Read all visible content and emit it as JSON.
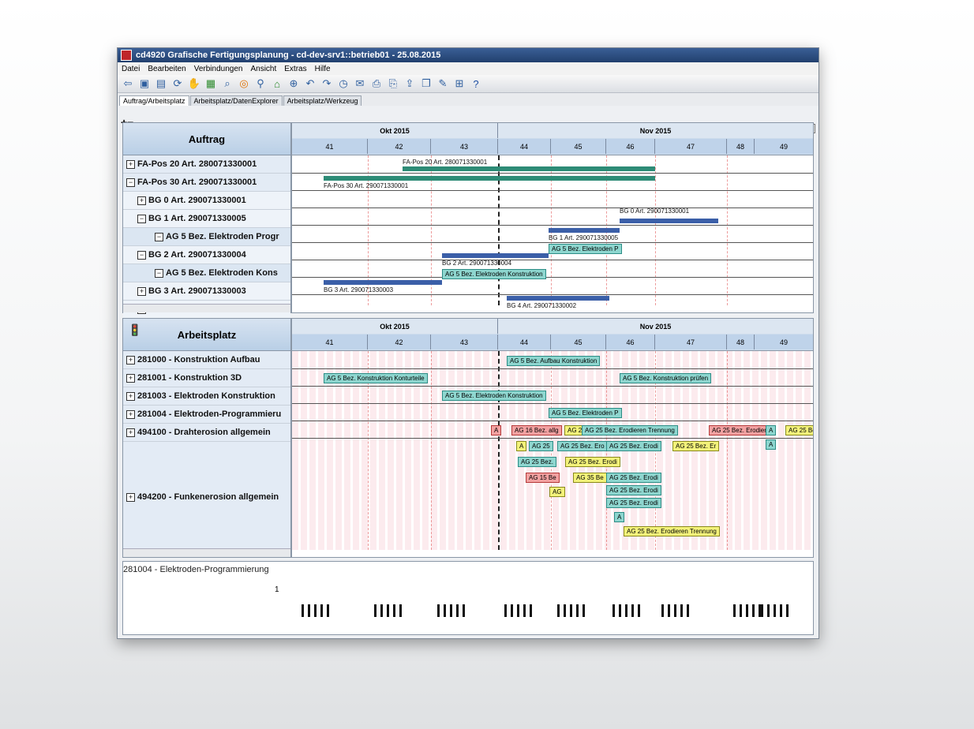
{
  "window": {
    "title": "cd4920 Grafische Fertigungsplanung - cd-dev-srv1::betrieb01 - 25.08.2015",
    "menu": [
      "Datei",
      "Bearbeiten",
      "Verbindungen",
      "Ansicht",
      "Extras",
      "Hilfe"
    ],
    "tabs": [
      "Auftrag/Arbeitsplatz",
      "Arbeitsplatz/DatenExplorer",
      "Arbeitsplatz/Werkzeug"
    ]
  },
  "toolbar_icons": [
    "exit-icon",
    "save-icon",
    "save-all-icon",
    "refresh-icon",
    "hand-icon",
    "list-icon",
    "zoom-icon",
    "target-icon",
    "search-icon",
    "tree-icon",
    "zoom-in-icon",
    "undo-icon",
    "redo-icon",
    "clock-icon",
    "mail-icon",
    "print-icon",
    "print-preview-icon",
    "export-icon",
    "copy-icon",
    "tools-icon",
    "table-icon",
    "help-icon"
  ],
  "upper": {
    "header": "Auftrag",
    "rows": [
      {
        "toggle": "+",
        "label": "FA-Pos 20 Art. 280071330001",
        "indent": 0
      },
      {
        "toggle": "−",
        "label": "FA-Pos 30 Art. 290071330001",
        "indent": 0
      },
      {
        "toggle": "+",
        "label": "BG 0  Art. 290071330001",
        "indent": 1
      },
      {
        "toggle": "−",
        "label": "BG 1  Art. 290071330005",
        "indent": 1
      },
      {
        "toggle": "−",
        "label": "AG 5 Bez. Elektroden Progr",
        "indent": 2
      },
      {
        "toggle": "−",
        "label": "BG 2  Art. 290071330004",
        "indent": 1
      },
      {
        "toggle": "−",
        "label": "AG 5 Bez. Elektroden Kons",
        "indent": 2
      },
      {
        "toggle": "+",
        "label": "BG 3  Art. 290071330003",
        "indent": 1
      },
      {
        "toggle": "+",
        "label": "BG 4  Art. 290071330002",
        "indent": 1
      }
    ]
  },
  "timeline": {
    "months": [
      {
        "label": "Okt 2015"
      },
      {
        "label": "Nov 2015"
      }
    ],
    "weeks": [
      "41",
      "42",
      "43",
      "44",
      "45",
      "46",
      "47",
      "48",
      "49"
    ]
  },
  "upper_bars": [
    {
      "label": "FA-Pos 20 Art. 280071330001"
    },
    {
      "label": "FA-Pos 30 Art. 290071330001"
    },
    {
      "label": "BG 0  Art. 290071330001"
    },
    {
      "label": "BG 1  Art. 290071330005"
    },
    {
      "label": "AG 5 Bez. Elektroden P"
    },
    {
      "label": "BG 2  Art. 290071330004"
    },
    {
      "label": "AG 5 Bez. Elektroden Konstruktion"
    },
    {
      "label": "BG 3  Art. 290071330003"
    },
    {
      "label": "BG 4  Art. 290071330002"
    }
  ],
  "lower": {
    "header": "Arbeitsplatz",
    "rows": [
      {
        "label": "281000 - Konstruktion Aufbau"
      },
      {
        "label": "281001 - Konstruktion 3D"
      },
      {
        "label": "281003 - Elektroden Konstruktion"
      },
      {
        "label": "281004 - Elektroden-Programmieru"
      },
      {
        "label": "494100 - Drahterosion allgemein"
      },
      {
        "label": "494200 - Funkenerosion allgemein"
      }
    ]
  },
  "lower_chips": [
    {
      "label": "AG 5 Bez. Aufbau Konstruktion",
      "color": "teal"
    },
    {
      "label": "AG 5 Bez.  Konstruktion Konturteile",
      "color": "teal"
    },
    {
      "label": "AG 5 Bez. Konstruktion prüfen",
      "color": "teal"
    },
    {
      "label": "AG 5 Bez. Elektroden Konstruktion",
      "color": "teal"
    },
    {
      "label": "AG 5 Bez. Elektroden P",
      "color": "teal"
    },
    {
      "label": "A",
      "color": "red"
    },
    {
      "label": "AG 16 Bez. allg",
      "color": "red"
    },
    {
      "label": "AG 2",
      "color": "yel"
    },
    {
      "label": "AG 25 Bez. Erodieren Trennung",
      "color": "teal"
    },
    {
      "label": "AG 25 Bez. Erodiere",
      "color": "red"
    },
    {
      "label": "A",
      "color": "teal"
    },
    {
      "label": "AG 25 Bez",
      "color": "yel"
    },
    {
      "label": "A",
      "color": "yel"
    },
    {
      "label": "AG 25",
      "color": "teal"
    },
    {
      "label": "AG 25 Bez. Ero",
      "color": "teal"
    },
    {
      "label": "AG 25 Bez. Erodi",
      "color": "teal"
    },
    {
      "label": "AG 25 Bez. Er",
      "color": "yel"
    },
    {
      "label": "A",
      "color": "teal"
    },
    {
      "label": "AG 25 Bez.",
      "color": "teal"
    },
    {
      "label": "AG 25 Bez. Erodi",
      "color": "yel"
    },
    {
      "label": "AG 15 Be",
      "color": "red"
    },
    {
      "label": "AG 35 Be",
      "color": "yel"
    },
    {
      "label": "AG 25 Bez. Erodi",
      "color": "teal"
    },
    {
      "label": "AG",
      "color": "yel"
    },
    {
      "label": "AG 25 Bez. Erodi",
      "color": "teal"
    },
    {
      "label": "AG 25 Bez. Erodi",
      "color": "teal"
    },
    {
      "label": "A",
      "color": "teal"
    },
    {
      "label": "AG 25 Bez. Erodieren Trennung",
      "color": "yel"
    }
  ],
  "capacity": {
    "label": "281004 - Elektroden-Programmierung",
    "scale": "1"
  }
}
